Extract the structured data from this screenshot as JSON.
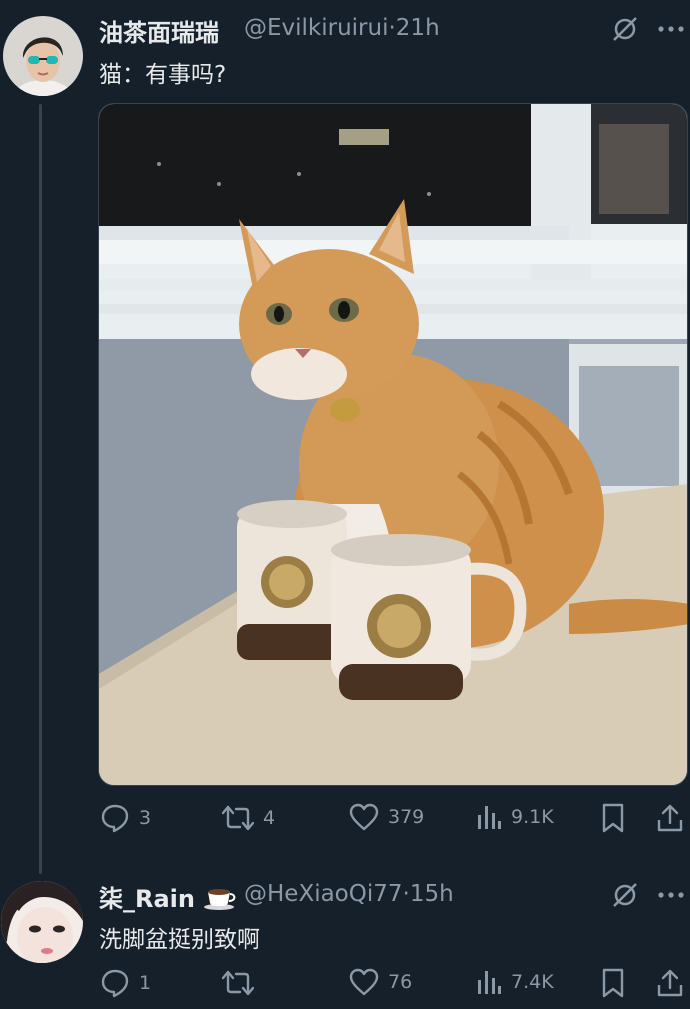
{
  "colors": {
    "background": "#15202b",
    "text": "#e7e9ea",
    "muted": "#8b98a5",
    "thread_line": "#38444d"
  },
  "tweets": [
    {
      "display_name": "油茶面瑞瑞",
      "handle": "@Evilkiruirui",
      "sep": "·",
      "time": "21h",
      "text": "猫：有事吗?",
      "metrics": {
        "replies": "3",
        "retweets": "4",
        "likes": "379",
        "views": "9.1K"
      },
      "icons": [
        "grok-icon",
        "more-icon",
        "reply-icon",
        "retweet-icon",
        "like-icon",
        "views-icon",
        "bookmark-icon",
        "share-icon"
      ]
    },
    {
      "display_name": "柒_Rain",
      "name_emoji": "coffee-cup-icon",
      "handle": "@HeXiaoQi77",
      "sep": "·",
      "time": "15h",
      "text": "洗脚盆挺别致啊",
      "metrics": {
        "replies": "1",
        "retweets": "",
        "likes": "76",
        "views": "7.4K"
      },
      "icons": [
        "grok-icon",
        "more-icon",
        "reply-icon",
        "retweet-icon",
        "like-icon",
        "views-icon",
        "bookmark-icon",
        "share-icon"
      ]
    }
  ]
}
